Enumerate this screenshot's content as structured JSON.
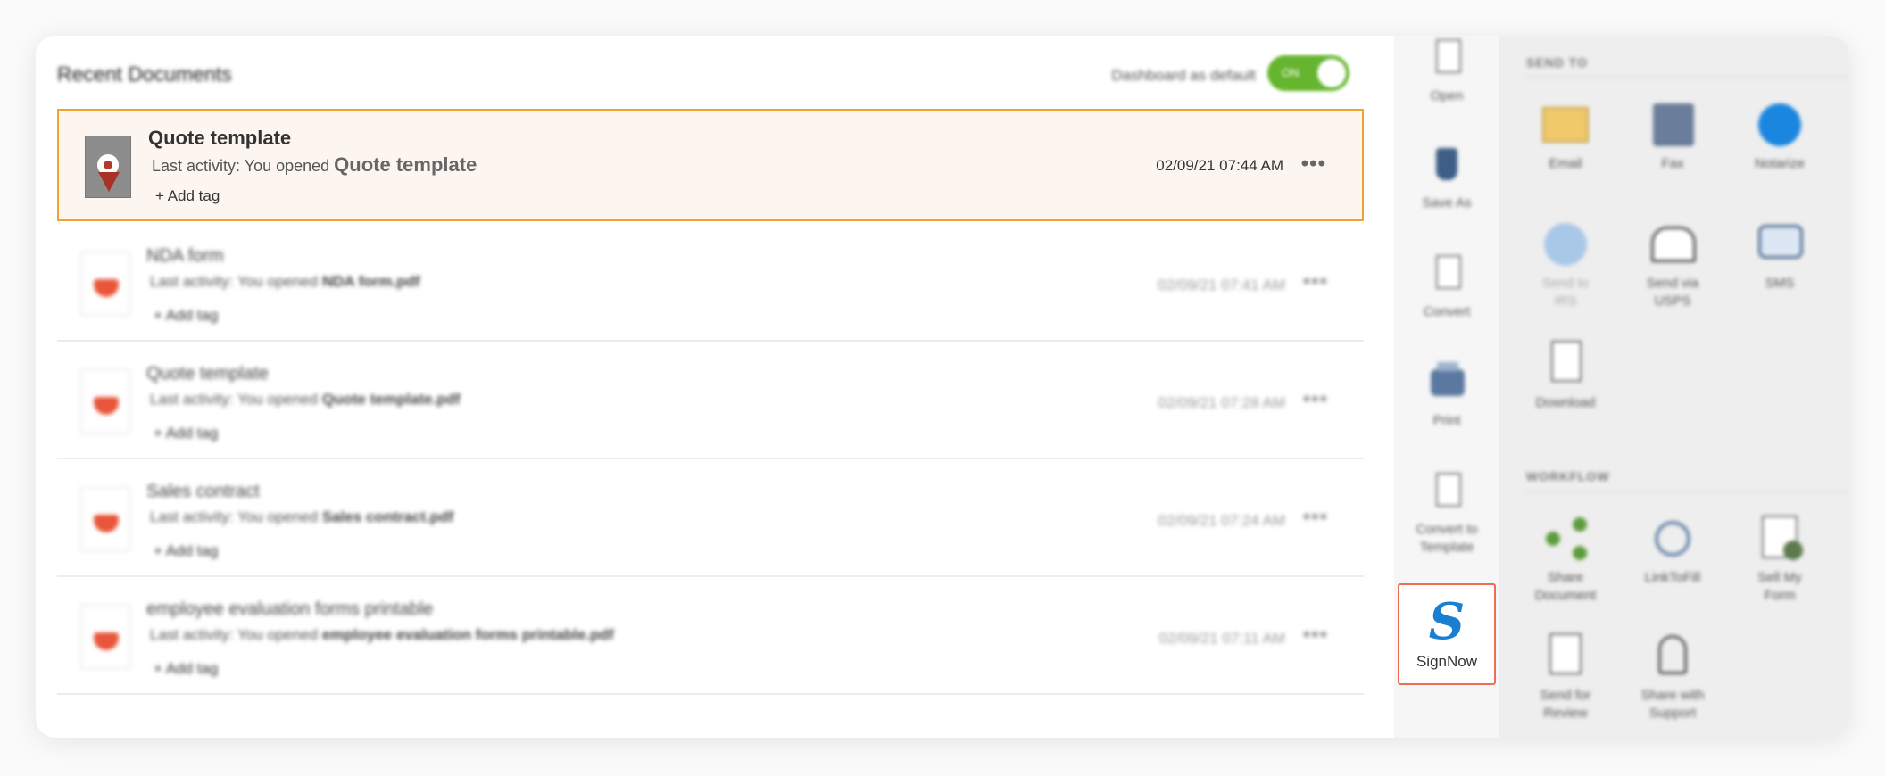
{
  "dashboard": {
    "title": "Recent Documents",
    "default_label": "Dashboard as default",
    "toggle_state": "ON"
  },
  "documents": [
    {
      "name": "Quote template",
      "activity_prefix": "Last activity: You opened",
      "activity_file": "Quote template",
      "add_tag": "+ Add tag",
      "date": "02/09/21 07:44 AM",
      "more": "•••"
    },
    {
      "name": "NDA form",
      "activity_prefix": "Last activity: You opened",
      "activity_file": "NDA form.pdf",
      "add_tag": "+ Add tag",
      "date": "02/09/21 07:41 AM",
      "more": "•••"
    },
    {
      "name": "Quote template",
      "activity_prefix": "Last activity: You opened",
      "activity_file": "Quote template.pdf",
      "add_tag": "+ Add tag",
      "date": "02/09/21 07:28 AM",
      "more": "•••"
    },
    {
      "name": "Sales contract",
      "activity_prefix": "Last activity: You opened",
      "activity_file": "Sales contract.pdf",
      "add_tag": "+ Add tag",
      "date": "02/09/21 07:24 AM",
      "more": "•••"
    },
    {
      "name": "employee evaluation forms printable",
      "activity_prefix": "Last activity: You opened",
      "activity_file": "employee evaluation forms printable.pdf",
      "add_tag": "+ Add tag",
      "date": "02/09/21 07:11 AM",
      "more": "•••"
    }
  ],
  "actions": [
    {
      "label": "Open",
      "icon": "open-icon"
    },
    {
      "label": "Save As",
      "icon": "save-as-icon"
    },
    {
      "label": "Convert",
      "icon": "convert-icon"
    },
    {
      "label": "Print",
      "icon": "print-icon"
    },
    {
      "label": "Convert to Template",
      "icon": "convert-to-template-icon"
    },
    {
      "label": "SignNow",
      "icon": "signnow-icon",
      "glyph": "S"
    }
  ],
  "send_to": {
    "heading": "SEND TO",
    "items": [
      {
        "label": "Email",
        "icon": "envelope-icon"
      },
      {
        "label": "Fax",
        "icon": "fax-icon"
      },
      {
        "label": "Notarize",
        "icon": "notarize-icon"
      },
      {
        "label": "Send to IRS",
        "icon": "irs-icon"
      },
      {
        "label": "Send via USPS",
        "icon": "mailbox-icon"
      },
      {
        "label": "SMS",
        "icon": "sms-icon"
      },
      {
        "label": "Download",
        "icon": "download-icon"
      }
    ]
  },
  "workflow": {
    "heading": "WORKFLOW",
    "items": [
      {
        "label": "Share Document",
        "icon": "share-icon"
      },
      {
        "label": "LinkToFill",
        "icon": "link-icon"
      },
      {
        "label": "Sell My Form",
        "icon": "sell-form-icon"
      },
      {
        "label": "Send for Review",
        "icon": "review-icon"
      },
      {
        "label": "Share with Support",
        "icon": "support-icon"
      }
    ]
  },
  "colors": {
    "accent_orange": "#f0a430",
    "toggle_green": "#66b52e",
    "signnow_blue": "#1a7fd0",
    "signnow_border": "#ef6d55"
  }
}
